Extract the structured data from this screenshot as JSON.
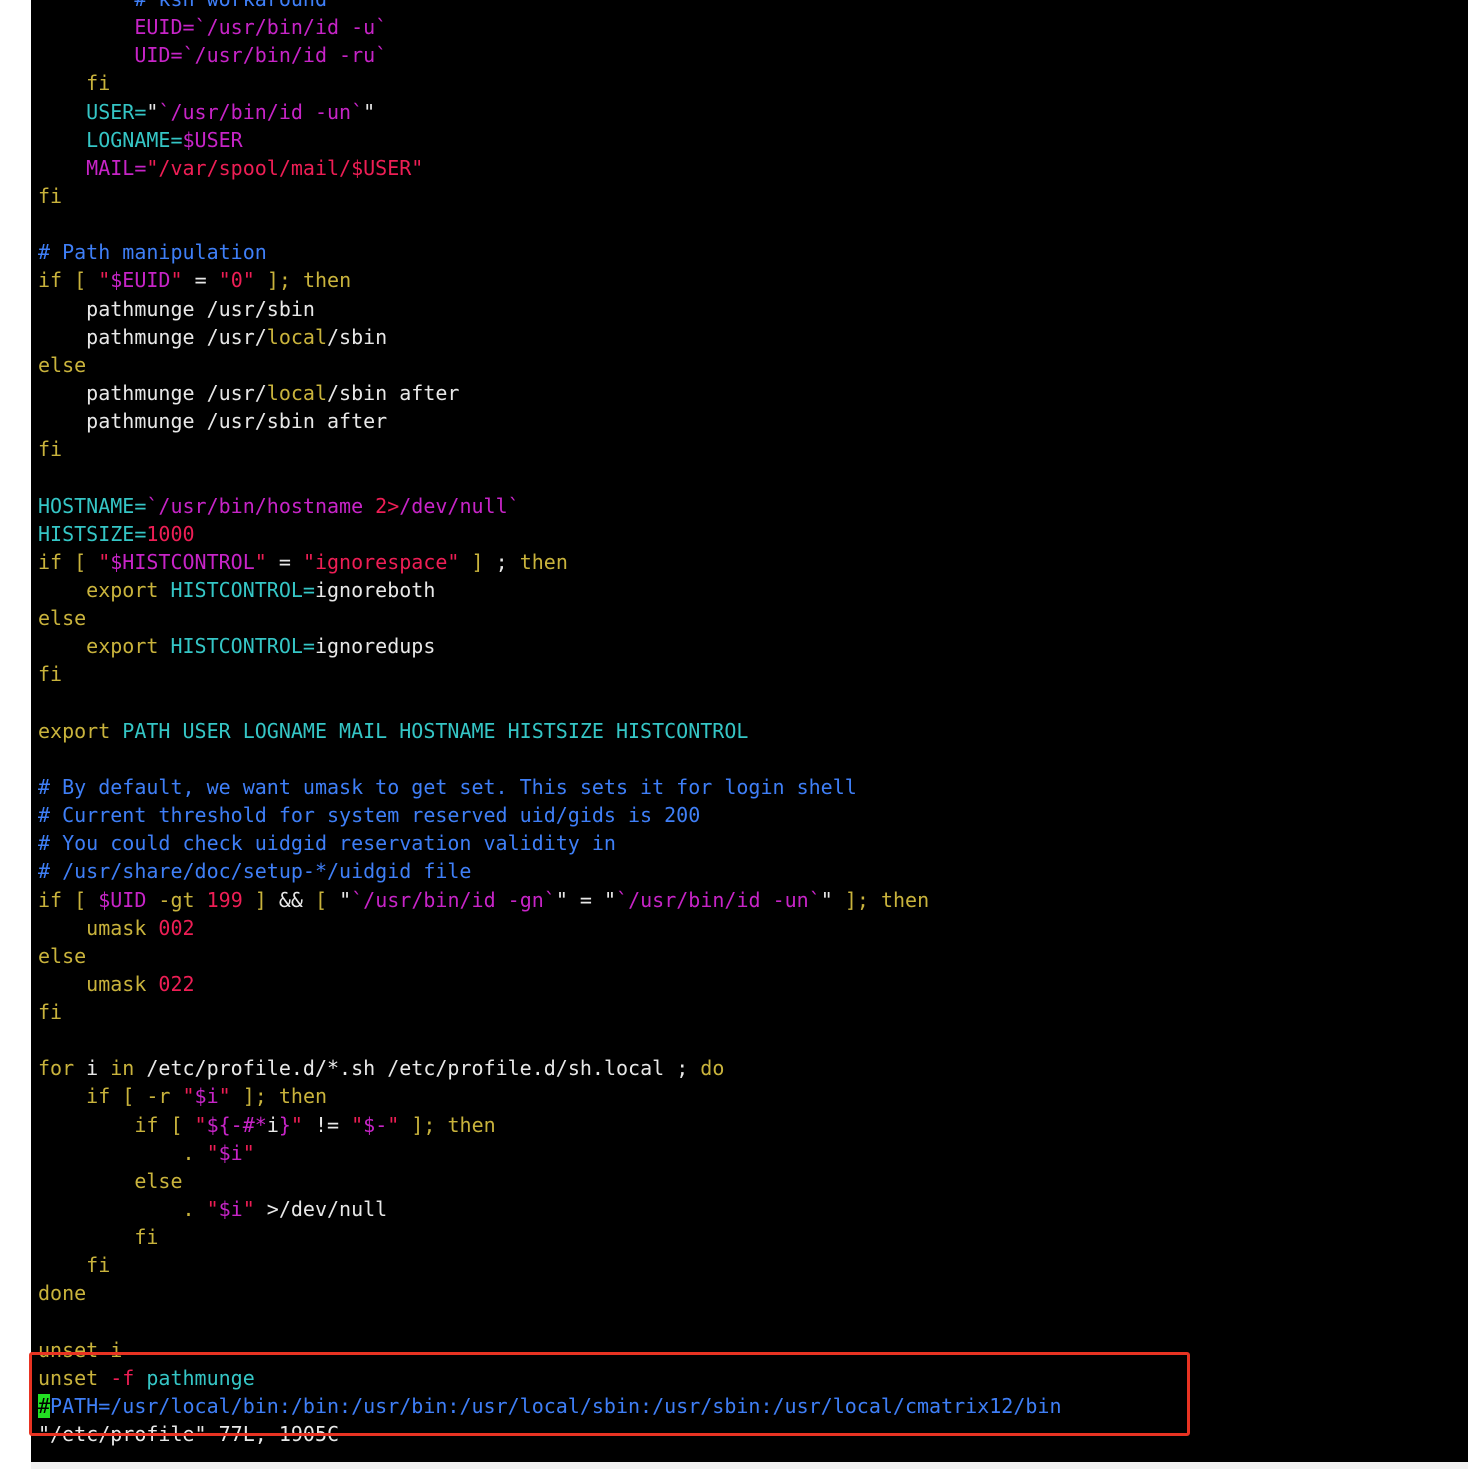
{
  "terminal": {
    "colors": {
      "default": "#e8e8e8",
      "keyword": "#c9b33c",
      "comment": "#3f7ff7",
      "string": "#ee1e55",
      "variable": "#c724c7",
      "identifier": "#35c6c6",
      "cursor_bg": "#22e022",
      "highlight_border": "#e83322"
    },
    "lines": [
      [
        {
          "t": "        # ksh workaround",
          "c": "comment"
        }
      ],
      [
        {
          "t": "        EUID=",
          "c": "variable"
        },
        {
          "t": "`/usr/bin/id -u`",
          "c": "variable"
        }
      ],
      [
        {
          "t": "        UID=",
          "c": "variable"
        },
        {
          "t": "`/usr/bin/id -ru`",
          "c": "variable"
        }
      ],
      [
        {
          "t": "    fi",
          "c": "keyword"
        }
      ],
      [
        {
          "t": "    USER=",
          "c": "identifier"
        },
        {
          "t": "\"",
          "c": "default"
        },
        {
          "t": "`/usr/bin/id -un`",
          "c": "variable"
        },
        {
          "t": "\"",
          "c": "default"
        }
      ],
      [
        {
          "t": "    LOGNAME=",
          "c": "identifier"
        },
        {
          "t": "$USER",
          "c": "variable"
        }
      ],
      [
        {
          "t": "    MAIL=",
          "c": "variable"
        },
        {
          "t": "\"/var/spool/mail/$USER\"",
          "c": "string"
        }
      ],
      [
        {
          "t": "fi",
          "c": "keyword"
        }
      ],
      [
        {
          "t": "",
          "c": "default"
        }
      ],
      [
        {
          "t": "# Path manipulation",
          "c": "comment"
        }
      ],
      [
        {
          "t": "if [ ",
          "c": "keyword"
        },
        {
          "t": "\"",
          "c": "string"
        },
        {
          "t": "$EUID",
          "c": "variable"
        },
        {
          "t": "\"",
          "c": "string"
        },
        {
          "t": " = ",
          "c": "default"
        },
        {
          "t": "\"0\"",
          "c": "string"
        },
        {
          "t": " ]; ",
          "c": "keyword"
        },
        {
          "t": "then",
          "c": "keyword"
        }
      ],
      [
        {
          "t": "    pathmunge /usr/sbin",
          "c": "default"
        }
      ],
      [
        {
          "t": "    pathmunge /usr/",
          "c": "default"
        },
        {
          "t": "local",
          "c": "keyword"
        },
        {
          "t": "/sbin",
          "c": "default"
        }
      ],
      [
        {
          "t": "else",
          "c": "keyword"
        }
      ],
      [
        {
          "t": "    pathmunge /usr/",
          "c": "default"
        },
        {
          "t": "local",
          "c": "keyword"
        },
        {
          "t": "/sbin after",
          "c": "default"
        }
      ],
      [
        {
          "t": "    pathmunge /usr/sbin after",
          "c": "default"
        }
      ],
      [
        {
          "t": "fi",
          "c": "keyword"
        }
      ],
      [
        {
          "t": "",
          "c": "default"
        }
      ],
      [
        {
          "t": "HOSTNAME=",
          "c": "identifier"
        },
        {
          "t": "`/usr/bin/hostname ",
          "c": "variable"
        },
        {
          "t": "2>",
          "c": "string"
        },
        {
          "t": "/dev/null`",
          "c": "variable"
        }
      ],
      [
        {
          "t": "HISTSIZE=",
          "c": "identifier"
        },
        {
          "t": "1000",
          "c": "string"
        }
      ],
      [
        {
          "t": "if [ ",
          "c": "keyword"
        },
        {
          "t": "\"",
          "c": "string"
        },
        {
          "t": "$HISTCONTROL",
          "c": "variable"
        },
        {
          "t": "\"",
          "c": "string"
        },
        {
          "t": " = ",
          "c": "default"
        },
        {
          "t": "\"ignorespace\"",
          "c": "string"
        },
        {
          "t": " ] ",
          "c": "keyword"
        },
        {
          "t": "; ",
          "c": "default"
        },
        {
          "t": "then",
          "c": "keyword"
        }
      ],
      [
        {
          "t": "    export ",
          "c": "keyword"
        },
        {
          "t": "HISTCONTROL=",
          "c": "identifier"
        },
        {
          "t": "ignoreboth",
          "c": "default"
        }
      ],
      [
        {
          "t": "else",
          "c": "keyword"
        }
      ],
      [
        {
          "t": "    export ",
          "c": "keyword"
        },
        {
          "t": "HISTCONTROL=",
          "c": "identifier"
        },
        {
          "t": "ignoredups",
          "c": "default"
        }
      ],
      [
        {
          "t": "fi",
          "c": "keyword"
        }
      ],
      [
        {
          "t": "",
          "c": "default"
        }
      ],
      [
        {
          "t": "export ",
          "c": "keyword"
        },
        {
          "t": "PATH USER LOGNAME MAIL HOSTNAME HISTSIZE HISTCONTROL",
          "c": "identifier"
        }
      ],
      [
        {
          "t": "",
          "c": "default"
        }
      ],
      [
        {
          "t": "# By default, we want umask to get set. This sets it for login shell",
          "c": "comment"
        }
      ],
      [
        {
          "t": "# Current threshold for system reserved uid/gids is 200",
          "c": "comment"
        }
      ],
      [
        {
          "t": "# You could check uidgid reservation validity in",
          "c": "comment"
        }
      ],
      [
        {
          "t": "# /usr/share/doc/setup-*/uidgid file",
          "c": "comment"
        }
      ],
      [
        {
          "t": "if [ ",
          "c": "keyword"
        },
        {
          "t": "$UID",
          "c": "variable"
        },
        {
          "t": " -gt ",
          "c": "keyword"
        },
        {
          "t": "199",
          "c": "string"
        },
        {
          "t": " ] ",
          "c": "keyword"
        },
        {
          "t": "&& ",
          "c": "default"
        },
        {
          "t": "[ ",
          "c": "keyword"
        },
        {
          "t": "\"",
          "c": "default"
        },
        {
          "t": "`/usr/bin/id -gn`",
          "c": "variable"
        },
        {
          "t": "\"",
          "c": "default"
        },
        {
          "t": " = ",
          "c": "default"
        },
        {
          "t": "\"",
          "c": "default"
        },
        {
          "t": "`/usr/bin/id -un`",
          "c": "variable"
        },
        {
          "t": "\"",
          "c": "default"
        },
        {
          "t": " ]; ",
          "c": "keyword"
        },
        {
          "t": "then",
          "c": "keyword"
        }
      ],
      [
        {
          "t": "    umask ",
          "c": "keyword"
        },
        {
          "t": "002",
          "c": "string"
        }
      ],
      [
        {
          "t": "else",
          "c": "keyword"
        }
      ],
      [
        {
          "t": "    umask ",
          "c": "keyword"
        },
        {
          "t": "022",
          "c": "string"
        }
      ],
      [
        {
          "t": "fi",
          "c": "keyword"
        }
      ],
      [
        {
          "t": "",
          "c": "default"
        }
      ],
      [
        {
          "t": "for ",
          "c": "keyword"
        },
        {
          "t": "i ",
          "c": "default"
        },
        {
          "t": "in ",
          "c": "keyword"
        },
        {
          "t": "/etc/profile.d/*.sh /etc/profile.d/sh.local ; ",
          "c": "default"
        },
        {
          "t": "do",
          "c": "keyword"
        }
      ],
      [
        {
          "t": "    if [ ",
          "c": "keyword"
        },
        {
          "t": "-r ",
          "c": "keyword"
        },
        {
          "t": "\"",
          "c": "string"
        },
        {
          "t": "$i",
          "c": "variable"
        },
        {
          "t": "\"",
          "c": "string"
        },
        {
          "t": " ]; ",
          "c": "keyword"
        },
        {
          "t": "then",
          "c": "keyword"
        }
      ],
      [
        {
          "t": "        if [ ",
          "c": "keyword"
        },
        {
          "t": "\"",
          "c": "string"
        },
        {
          "t": "${-#*",
          "c": "variable"
        },
        {
          "t": "i",
          "c": "default"
        },
        {
          "t": "}",
          "c": "variable"
        },
        {
          "t": "\"",
          "c": "string"
        },
        {
          "t": " != ",
          "c": "default"
        },
        {
          "t": "\"",
          "c": "string"
        },
        {
          "t": "$-",
          "c": "variable"
        },
        {
          "t": "\"",
          "c": "string"
        },
        {
          "t": " ]; ",
          "c": "keyword"
        },
        {
          "t": "then",
          "c": "keyword"
        }
      ],
      [
        {
          "t": "            . ",
          "c": "keyword"
        },
        {
          "t": "\"",
          "c": "string"
        },
        {
          "t": "$i",
          "c": "variable"
        },
        {
          "t": "\"",
          "c": "string"
        }
      ],
      [
        {
          "t": "        else",
          "c": "keyword"
        }
      ],
      [
        {
          "t": "            . ",
          "c": "keyword"
        },
        {
          "t": "\"",
          "c": "string"
        },
        {
          "t": "$i",
          "c": "variable"
        },
        {
          "t": "\"",
          "c": "string"
        },
        {
          "t": " >/dev/null",
          "c": "default"
        }
      ],
      [
        {
          "t": "        fi",
          "c": "keyword"
        }
      ],
      [
        {
          "t": "    fi",
          "c": "keyword"
        }
      ],
      [
        {
          "t": "done",
          "c": "keyword"
        }
      ],
      [
        {
          "t": "",
          "c": "default"
        }
      ],
      [
        {
          "t": "unset i",
          "c": "keyword"
        }
      ],
      [
        {
          "t": "unset ",
          "c": "keyword"
        },
        {
          "t": "-f ",
          "c": "string"
        },
        {
          "t": "pathmunge",
          "c": "identifier"
        }
      ],
      [
        {
          "t": "#",
          "c": "cursor"
        },
        {
          "t": "PATH=/usr/local/bin:/bin:/usr/bin:/usr/local/sbin:/usr/sbin:/usr/local/cmatrix12/bin",
          "c": "comment"
        }
      ],
      [
        {
          "t": "\"/etc/profile\" 77L, 1905C",
          "c": "default"
        }
      ]
    ]
  }
}
